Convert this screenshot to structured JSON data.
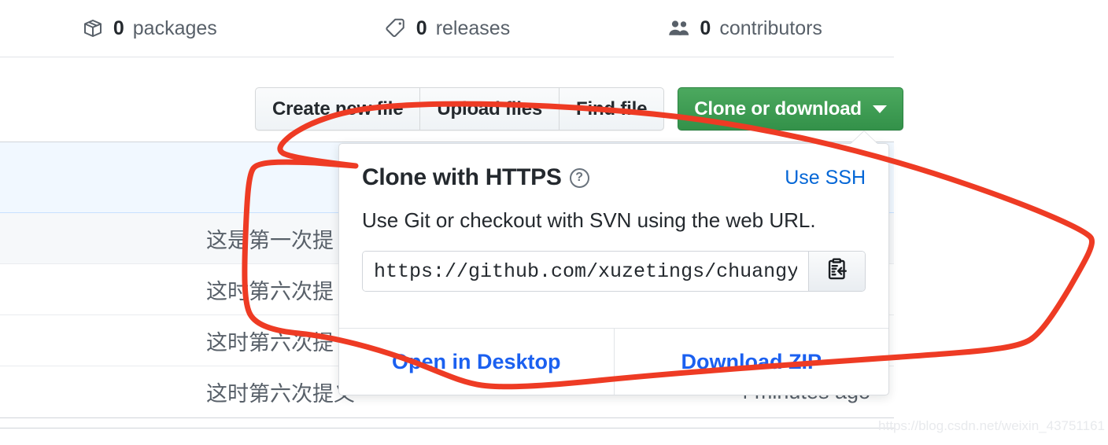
{
  "stats": [
    {
      "icon": "package-icon",
      "count": "0",
      "label": "packages"
    },
    {
      "icon": "tag-icon",
      "count": "0",
      "label": "releases"
    },
    {
      "icon": "people-icon",
      "count": "0",
      "label": "contributors"
    }
  ],
  "toolbar": {
    "create_new_file": "Create new file",
    "upload_files": "Upload files",
    "find_file": "Find file",
    "clone_or_download": "Clone or download"
  },
  "clone_panel": {
    "title": "Clone with HTTPS",
    "help_icon": "?",
    "use_ssh": "Use SSH",
    "description": "Use Git or checkout with SVN using the web URL.",
    "url_value": "https://github.com/xuzetings/chuangye",
    "url_placeholder": "https://github.com/",
    "copy_icon": "clipboard-copy-icon",
    "open_in_desktop": "Open in Desktop",
    "download_zip": "Download ZIP"
  },
  "file_table": {
    "rows": [
      {
        "message": "这是第一次提",
        "time": ""
      },
      {
        "message": "这时第六次提",
        "time": ""
      },
      {
        "message": "这时第六次提",
        "time": ""
      },
      {
        "message": "这时第六次提义",
        "time": "4 minutes ago"
      }
    ]
  },
  "annotation": {
    "color": "#ee3b24",
    "shape": "hand-drawn-ellipse-highlight"
  },
  "watermark": "https://blog.csdn.net/weixin_43751161",
  "colors": {
    "green_button": "#2c974b",
    "link_blue": "#0366d6",
    "footer_link_blue": "#1b60f0",
    "annotation_red": "#ee3b24",
    "row_highlight": "#f1f8ff"
  }
}
